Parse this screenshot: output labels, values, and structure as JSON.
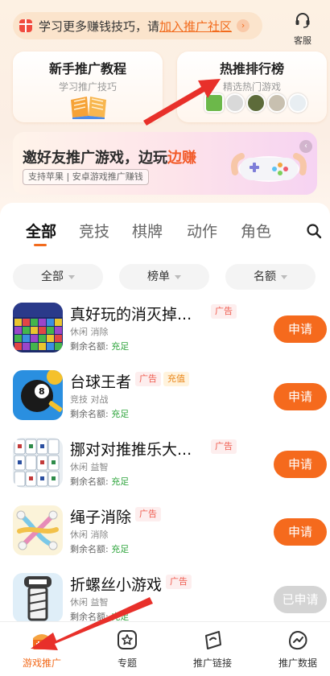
{
  "notice": {
    "text": "学习更多赚钱技巧，请",
    "link": "加入推广社区",
    "arrow": "›"
  },
  "service": {
    "label": "客服"
  },
  "cards": [
    {
      "title": "新手推广教程",
      "subtitle": "学习推广技巧"
    },
    {
      "title": "热推排行榜",
      "subtitle": "精选热门游戏"
    }
  ],
  "banner": {
    "title_part1": "邀好友推广游戏，边玩",
    "title_part2": "边赚",
    "tag": "支持苹果 | 安卓游戏推广赚钱",
    "collapse": "‹"
  },
  "tabs": [
    "全部",
    "竞技",
    "棋牌",
    "动作",
    "角色"
  ],
  "filters": [
    "全部",
    "榜单",
    "名额"
  ],
  "quota_label": "剩余名额:",
  "games": [
    {
      "name": "真好玩的消灭掉...",
      "badges": [
        "广告"
      ],
      "tags": "休闲 消除",
      "quota": "充足",
      "button": "申请",
      "applied": false
    },
    {
      "name": "台球王者",
      "badges": [
        "广告",
        "充值"
      ],
      "tags": "竞技 对战",
      "quota": "充足",
      "button": "申请",
      "applied": false
    },
    {
      "name": "挪对对推推乐大...",
      "badges": [
        "广告"
      ],
      "tags": "休闲 益智",
      "quota": "充足",
      "button": "申请",
      "applied": false
    },
    {
      "name": "绳子消除",
      "badges": [
        "广告"
      ],
      "tags": "休闲 消除",
      "quota": "充足",
      "button": "申请",
      "applied": false
    },
    {
      "name": "折螺丝小游戏",
      "badges": [
        "广告"
      ],
      "tags": "休闲 益智",
      "quota": "充足",
      "button": "已申请",
      "applied": true
    }
  ],
  "nav": [
    {
      "label": "游戏推广",
      "active": true
    },
    {
      "label": "专题",
      "active": false
    },
    {
      "label": "推广链接",
      "active": false
    },
    {
      "label": "推广数据",
      "active": false
    }
  ],
  "colors": {
    "accent": "#f56a1d",
    "quota_ok": "#2fa53d",
    "badge_ad": "#ef5a4d",
    "badge_charge": "#e9861a",
    "applied_button": "#d4d4d4"
  }
}
